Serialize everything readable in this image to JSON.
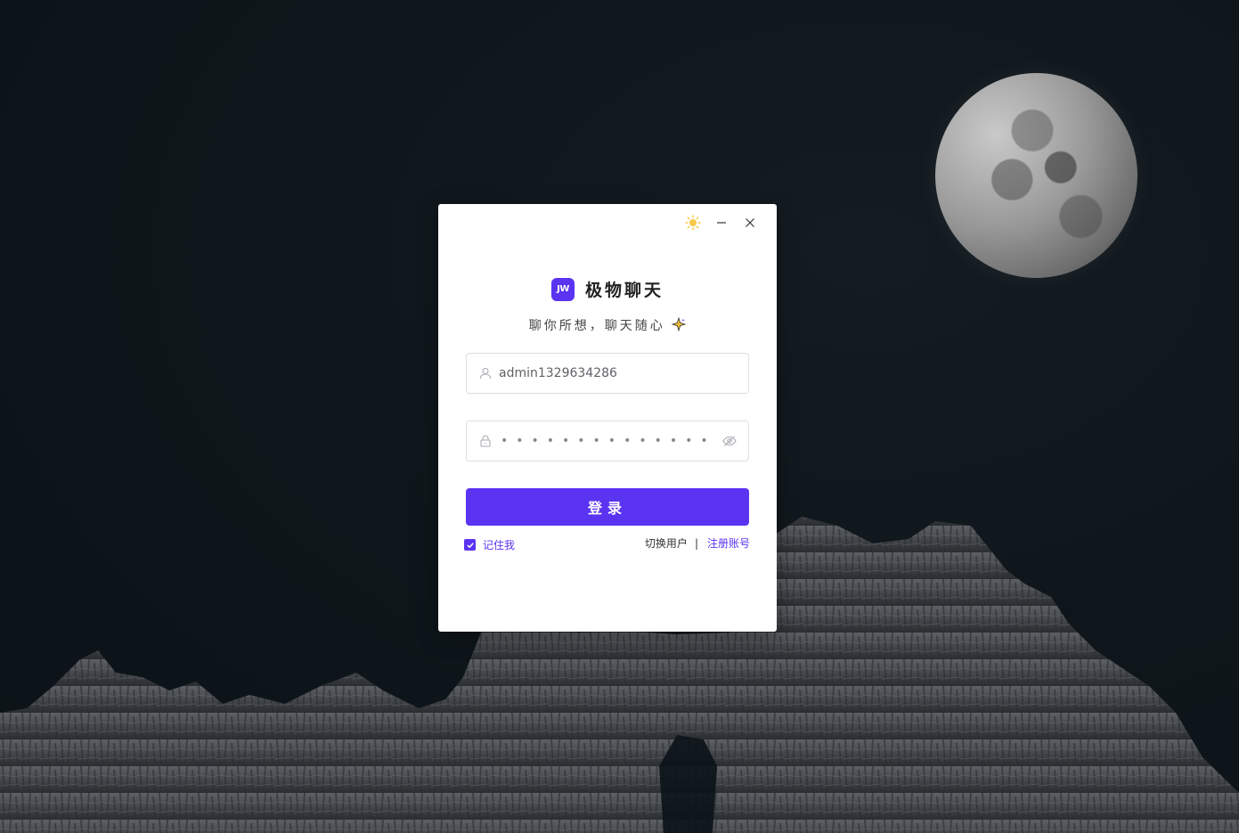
{
  "app": {
    "title": "极物聊天",
    "logo_text": "JW",
    "slogan": "聊你所想，聊天随心"
  },
  "window_controls": {
    "theme_icon": "sun-icon",
    "minimize_icon": "minimize-icon",
    "close_icon": "close-icon"
  },
  "form": {
    "username": {
      "value": "admin1329634286",
      "icon": "user-icon"
    },
    "password": {
      "masked": "••••••••••••••",
      "icon": "lock-icon",
      "toggle_icon": "eye-off-icon"
    },
    "login_label": "登录",
    "remember_label": "记住我",
    "remember_checked": true,
    "switch_user_label": "切换用户",
    "register_label": "注册账号"
  },
  "colors": {
    "accent": "#5b34f2",
    "background": "#0e161b",
    "card": "#ffffff"
  }
}
